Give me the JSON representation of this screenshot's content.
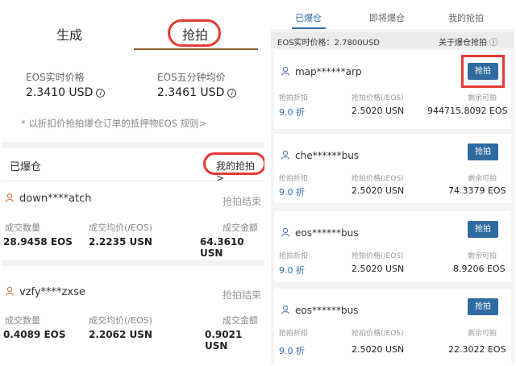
{
  "left": {
    "tabs": {
      "generate": "生成",
      "grab": "抢拍"
    },
    "prices": {
      "realtime_label": "EOS实时价格",
      "realtime_value": "2.3410 USD",
      "five_min_label": "EOS五分钟均价",
      "five_min_value": "2.3461 USD"
    },
    "note": "* 以折扣价抢拍爆仓订单的抵押物EOS  规则>",
    "section_title": "已爆仓",
    "my_grab_link": "我的抢拍 >",
    "records": [
      {
        "user": "down****atch",
        "status": "抢拍结束",
        "qty_label": "成交数量",
        "avg_label": "成交均价(/EOS)",
        "amount_label": "成交金额",
        "qty": "28.9458 EOS",
        "avg": "2.2235 USN",
        "amount": "64.3610 USN"
      },
      {
        "user": "vzfy****zxse",
        "status": "抢拍结束",
        "qty_label": "成交数量",
        "avg_label": "成交均价(/EOS)",
        "amount_label": "成交金额",
        "qty": "0.4089 EOS",
        "avg": "2.2062 USN",
        "amount": "0.9021 USN"
      }
    ]
  },
  "right": {
    "tabs": {
      "liquidated": "已爆仓",
      "upcoming": "即将爆仓",
      "mine": "我的抢拍"
    },
    "info": {
      "price": "EOS实时价格：2.7800USD",
      "about": "关于爆仓抢拍 ⓘ"
    },
    "cards": [
      {
        "user": "map******arp",
        "button": "抢拍",
        "discount_label": "抢拍折扣",
        "price_label": "抢拍价格(/EOS)",
        "remain_label": "剩余可拍",
        "discount": "9.0 折",
        "price": "2.5020 USN",
        "remain": "944715.8092 EOS"
      },
      {
        "user": "che******bus",
        "button": "抢拍",
        "discount_label": "抢拍折扣",
        "price_label": "抢拍价格(/EOS)",
        "remain_label": "剩余可拍",
        "discount": "9.0 折",
        "price": "2.5020 USN",
        "remain": "74.3379 EOS"
      },
      {
        "user": "eos******bus",
        "button": "抢拍",
        "discount_label": "抢拍折扣",
        "price_label": "抢拍价格(/EOS)",
        "remain_label": "剩余可拍",
        "discount": "9.0 折",
        "price": "2.5020 USN",
        "remain": "8.9206 EOS"
      },
      {
        "user": "eos******bus",
        "button": "抢拍",
        "discount_label": "抢拍折扣",
        "price_label": "抢拍价格(/EOS)",
        "remain_label": "剩余可拍",
        "discount": "9.0 折",
        "price": "2.5020 USN",
        "remain": "22.3022 EOS"
      }
    ]
  },
  "colors": {
    "accent_blue": "#2f6fa8",
    "button_blue": "#2f6aa0",
    "highlight_red": "#e53935",
    "tab_brown": "#8b5a2b"
  }
}
